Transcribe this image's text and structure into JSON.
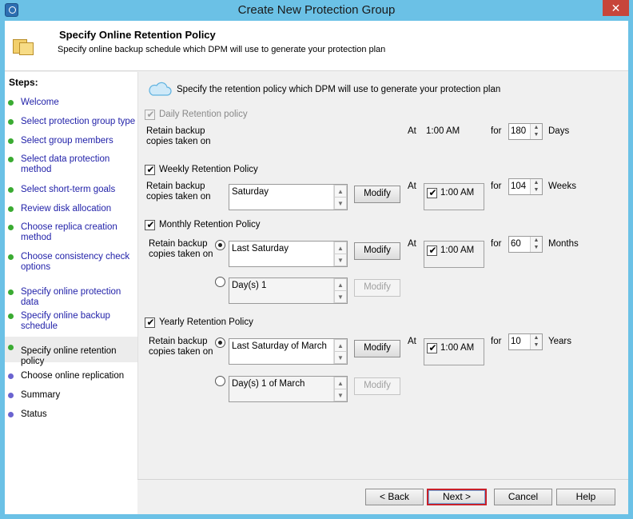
{
  "window": {
    "title": "Create New Protection Group",
    "close_glyph": "✕"
  },
  "header": {
    "title": "Specify Online Retention Policy",
    "subtitle": "Specify online backup schedule which DPM will use to generate your protection plan"
  },
  "steps": {
    "title": "Steps:",
    "items": [
      {
        "label": "Welcome",
        "status": "done"
      },
      {
        "label": "Select protection group type",
        "status": "done"
      },
      {
        "label": "Select group members",
        "status": "done"
      },
      {
        "label": "Select data protection method",
        "status": "done"
      },
      {
        "label": "Select short-term goals",
        "status": "done"
      },
      {
        "label": "Review disk allocation",
        "status": "done"
      },
      {
        "label": "Choose replica creation method",
        "status": "done"
      },
      {
        "label": "Choose consistency check options",
        "status": "done"
      },
      {
        "label": "Specify online protection data",
        "status": "done"
      },
      {
        "label": "Specify online backup schedule",
        "status": "done"
      },
      {
        "label": "Specify online retention policy",
        "status": "current"
      },
      {
        "label": "Choose online replication",
        "status": "pending"
      },
      {
        "label": "Summary",
        "status": "pending"
      },
      {
        "label": "Status",
        "status": "pending"
      }
    ]
  },
  "intro": "Specify the retention policy which DPM will use to generate your protection plan",
  "daily": {
    "label": "Daily Retention policy",
    "checked": true,
    "enabled": false,
    "retain_label": "Retain backup copies taken on",
    "at_label": "At",
    "time": "1:00 AM",
    "for_label": "for",
    "count": "180",
    "unit": "Days"
  },
  "weekly": {
    "label": "Weekly Retention Policy",
    "checked": true,
    "retain_label": "Retain backup copies taken on",
    "selection": "Saturday",
    "modify_label": "Modify",
    "at_label": "At",
    "time": "1:00 AM",
    "time_checked": true,
    "for_label": "for",
    "count": "104",
    "unit": "Weeks"
  },
  "monthly": {
    "label": "Monthly Retention Policy",
    "checked": true,
    "retain_label": "Retain backup copies taken on",
    "option1": "Last Saturday",
    "option2": "Day(s) 1",
    "selected_option": 1,
    "modify_label": "Modify",
    "at_label": "At",
    "time": "1:00 AM",
    "time_checked": true,
    "for_label": "for",
    "count": "60",
    "unit": "Months"
  },
  "yearly": {
    "label": "Yearly Retention Policy",
    "checked": true,
    "retain_label": "Retain backup copies taken on",
    "option1": "Last Saturday of March",
    "option2": "Day(s) 1 of March",
    "selected_option": 1,
    "modify_label": "Modify",
    "at_label": "At",
    "time": "1:00 AM",
    "time_checked": true,
    "for_label": "for",
    "count": "10",
    "unit": "Years"
  },
  "footer": {
    "back": "< Back",
    "next": "Next >",
    "cancel": "Cancel",
    "help": "Help"
  },
  "icons": {
    "check": "✔",
    "up": "▲",
    "down": "▼"
  },
  "colors": {
    "title_bar": "#6bc1e6",
    "step_done": "#3aab32",
    "step_pending": "#6a63d0",
    "link": "#1f1fa8",
    "next_highlight": "#c8202a"
  }
}
